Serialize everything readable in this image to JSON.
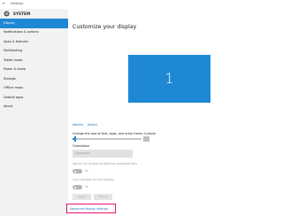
{
  "window": {
    "title": "Settings",
    "back_glyph": "←",
    "controls": {
      "minimize": "—",
      "maximize": "□",
      "close": "✕"
    }
  },
  "sidebar": {
    "header_icon": "gear-icon",
    "header_title": "SYSTEM",
    "items": [
      {
        "label": "Display",
        "active": true
      },
      {
        "label": "Notifications & actions"
      },
      {
        "label": "Apps & features"
      },
      {
        "label": "Multitasking"
      },
      {
        "label": "Tablet mode"
      },
      {
        "label": "Power & sleep"
      },
      {
        "label": "Storage"
      },
      {
        "label": "Offline maps"
      },
      {
        "label": "Default apps"
      },
      {
        "label": "About"
      }
    ]
  },
  "main": {
    "title": "Customize your display",
    "monitor_number": "1",
    "identify_link": "Identify",
    "detect_link": "Detect",
    "scale_label": "Change the size of text, apps, and other items: Custom",
    "orientation_label": "Orientation",
    "orientation_value": "Landscape",
    "brightness_label": "Adjust my display brightness automatically",
    "brightness_toggle": "On",
    "lock_rotation_label": "Lock rotation of this display",
    "lock_rotation_toggle": "On",
    "apply_button": "Apply",
    "cancel_button": "Cancel",
    "advanced_link": "Advanced display settings"
  },
  "colors": {
    "accent": "#1e88d4",
    "highlight_border": "#e8136f",
    "link": "#1e73b8",
    "sidebar_bg": "#f2f2f2"
  }
}
